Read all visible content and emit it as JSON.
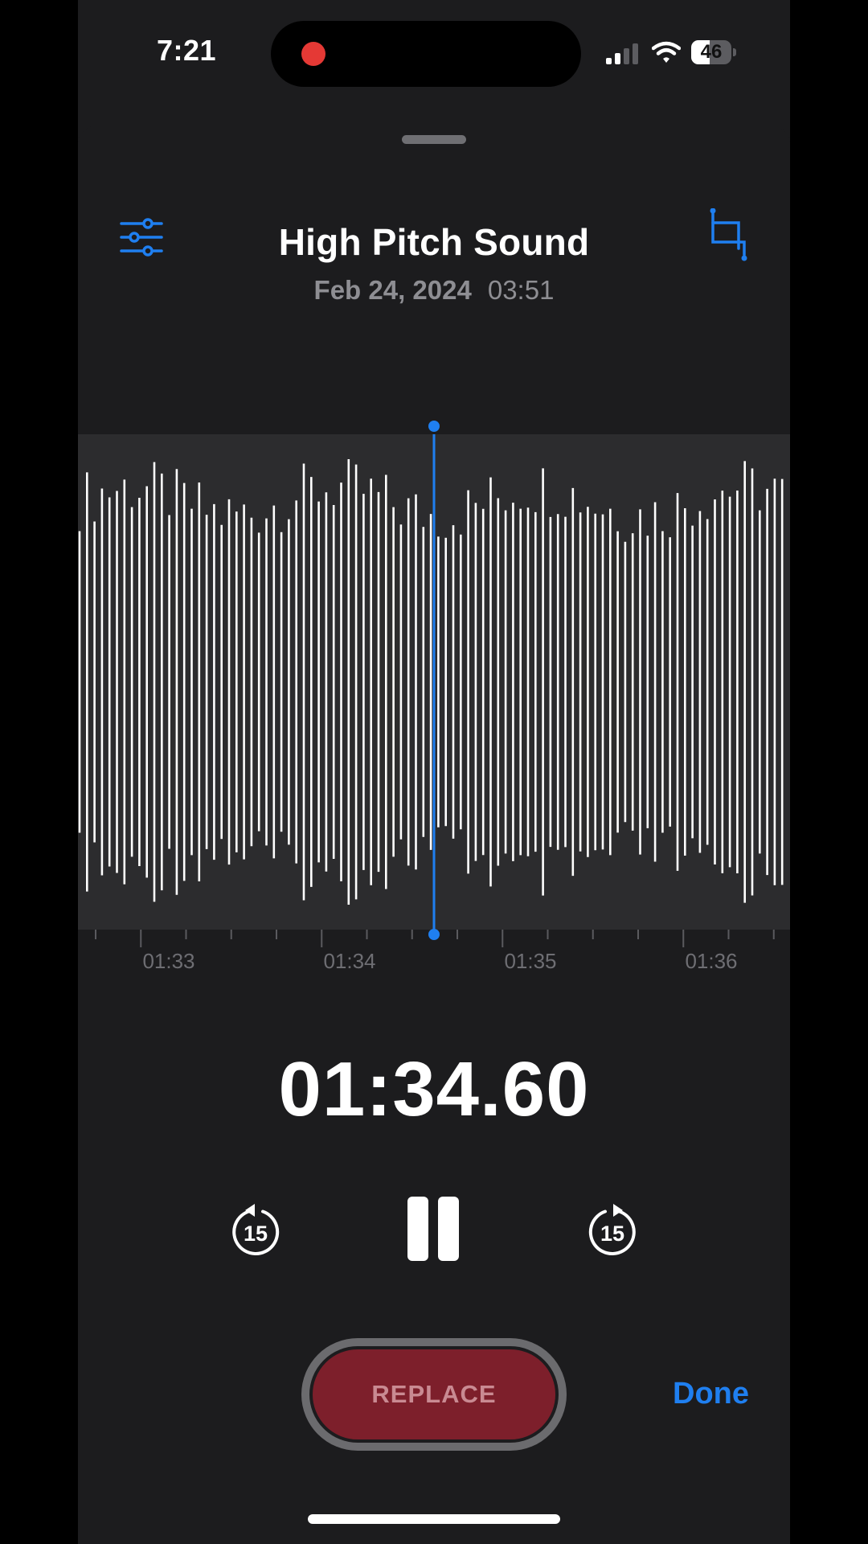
{
  "status_bar": {
    "time": "7:21",
    "battery_level": "46",
    "battery_percent": 46,
    "recording_indicator": "red-dot",
    "signal_bars_active": 2,
    "signal_bars_total": 4,
    "colors": {
      "recording": "#e53935",
      "text": "#ffffff"
    }
  },
  "recording": {
    "title": "High Pitch Sound",
    "date": "Feb 24, 2024",
    "duration": "03:51"
  },
  "toolbar": {
    "settings_icon": "sliders-icon",
    "trim_icon": "crop-icon"
  },
  "waveform": {
    "playhead_time": "01:34.60",
    "timeline_labels": [
      "01:33",
      "01:34",
      "01:35",
      "01:36"
    ],
    "accent_color": "#1f7ff0"
  },
  "playback": {
    "current_time": "01:34.60",
    "skip_back_label": "15",
    "skip_forward_label": "15",
    "state": "playing"
  },
  "actions": {
    "replace_label": "REPLACE",
    "done_label": "Done"
  },
  "colors": {
    "background": "#1c1c1e",
    "accent": "#1f7ff0",
    "replace_button": "#7d1f2b"
  }
}
